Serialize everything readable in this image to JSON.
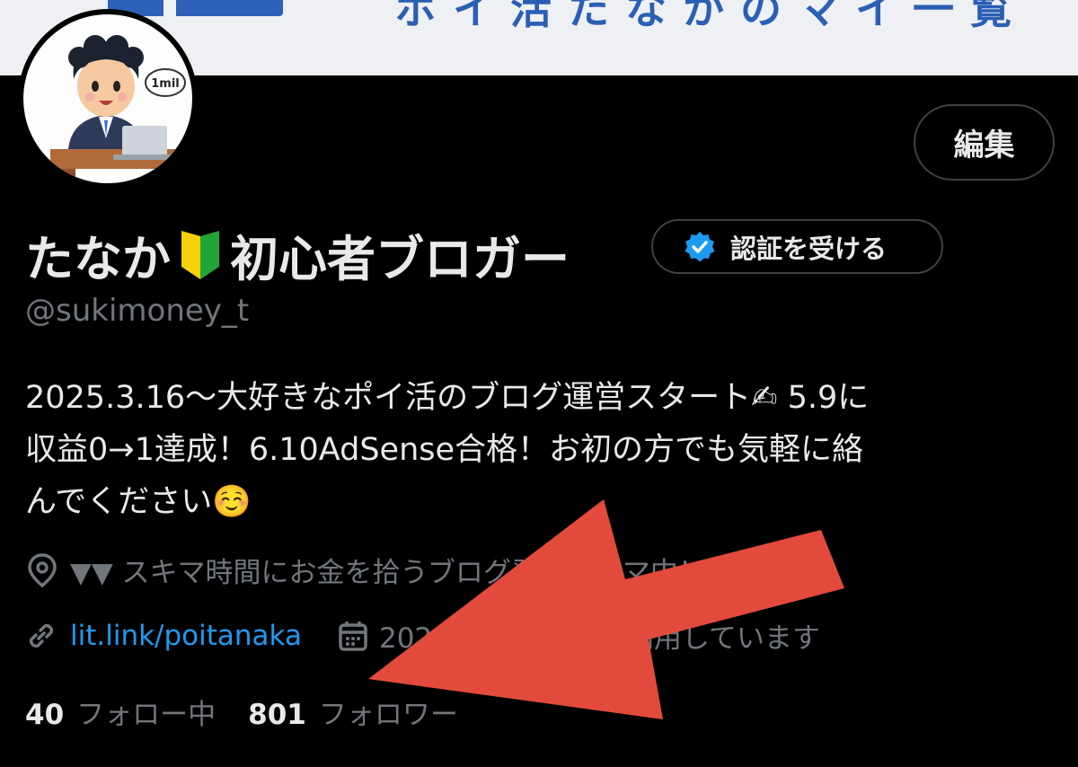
{
  "banner": {
    "text": "ポイ活たなかのマイ一覧"
  },
  "profile": {
    "avatar_badge": "1mil",
    "edit_label": "編集",
    "name_part1": "たなか",
    "name_part2": "初心者ブロガー",
    "verify_label": "認証を受ける",
    "handle": "@sukimoney_t",
    "bio": "2025.3.16～大好きなポイ活のブログ運営スタート✍ 5.9に\n収益0→1達成！6.10AdSense合格！お初の方でも気軽に絡\nんでください☺️",
    "location": "▼▼ スキマ時間にお金を拾うブログ発信スキマ中！ ▼▼",
    "link": "lit.link/poitanaka",
    "joined": "2025年3月からXを利用しています",
    "following_count": "40",
    "following_label": "フォロー中",
    "followers_count": "801",
    "followers_label": "フォロワー"
  },
  "icons": [
    "beginner-leaf-icon",
    "verified-check-icon",
    "location-pin-icon",
    "link-icon",
    "calendar-icon"
  ],
  "colors": {
    "background": "#000000",
    "text": "#e7e9ea",
    "muted": "#71767b",
    "link": "#1d9bf0",
    "arrow": "#e24b3c"
  }
}
